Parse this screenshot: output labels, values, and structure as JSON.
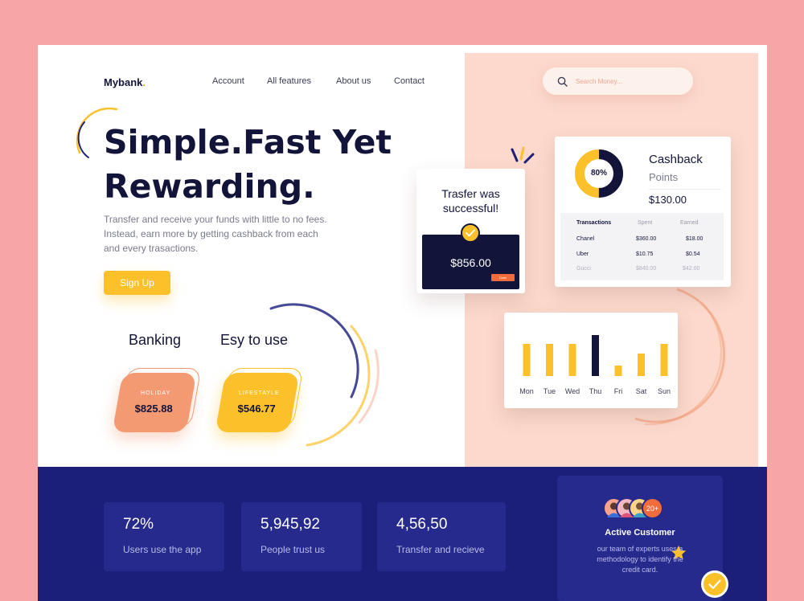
{
  "brand": {
    "name": "Mybank",
    "dot": ".",
    "accent": "#f5a623"
  },
  "nav": {
    "items": [
      "Account",
      "All features",
      "About us",
      "Contact"
    ]
  },
  "search": {
    "placeholder": "Search Money..."
  },
  "hero": {
    "title_line1": "Simple.Fast Yet",
    "title_line2": "Rewarding.",
    "subtitle_line1": "Transfer and receive your funds with little to no fees.",
    "subtitle_line2": "Instead, earn more by getting cashback from each",
    "subtitle_line3": "and every trasactions.",
    "cta": "Sign Up"
  },
  "features": [
    {
      "label": "Banking",
      "card_tag": "HOLIDAY",
      "card_amount": "$825.88",
      "color": "#f49a73"
    },
    {
      "label": "Esy to use",
      "card_tag": "LIFESTAYLE",
      "card_amount": "$546.77",
      "color": "#fcc12a"
    }
  ],
  "success": {
    "message_line1": "Trasfer was",
    "message_line2": "successful!",
    "amount": "$856.00",
    "done_label": "Done"
  },
  "cashback": {
    "percent_label": "80%",
    "percent": 80,
    "title": "Cashback",
    "subtitle": "Points",
    "value": "$130.00",
    "table": {
      "headers": [
        "Transactions",
        "Spent",
        "Earned"
      ],
      "rows": [
        [
          "Chanel",
          "$360.00",
          "$18.00"
        ],
        [
          "Uber",
          "$10.75",
          "$0.54"
        ],
        [
          "Gucci",
          "$840.00",
          "$42.00"
        ]
      ]
    }
  },
  "chart_data": {
    "type": "bar",
    "title": "",
    "categories": [
      "Mon",
      "Tue",
      "Wed",
      "Thu",
      "Fri",
      "Sat",
      "Sun"
    ],
    "values": [
      40,
      40,
      40,
      51,
      13,
      28,
      40
    ],
    "highlight_index": 3,
    "colors": {
      "bar": "#fcc12a",
      "highlight": "#12143a"
    },
    "grid": false
  },
  "stats": [
    {
      "value": "72%",
      "label": "Users use the app"
    },
    {
      "value": "5,945,92",
      "label": "People trust us"
    },
    {
      "value": "4,56,50",
      "label": "Transfer and recieve"
    }
  ],
  "customer": {
    "badge": "20+",
    "title": "Active Customer",
    "desc_line1": "our team of experts uses a",
    "desc_line2": "methodology to identify the",
    "desc_line3": "credit card."
  },
  "colors": {
    "navy": "#1c1f7a",
    "pink": "#fcd9cc",
    "yellow": "#fcc12a",
    "orange": "#f49a73"
  }
}
